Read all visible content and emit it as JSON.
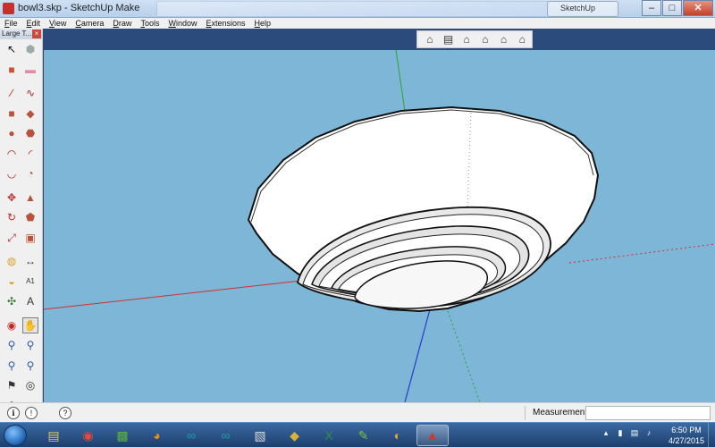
{
  "window": {
    "title": "bowl3.skp - SketchUp Make",
    "browser_tab": "SketchUp",
    "controls": {
      "minimize": "–",
      "maximize": "□",
      "close": "✕"
    }
  },
  "menu": [
    "File",
    "Edit",
    "View",
    "Camera",
    "Draw",
    "Tools",
    "Window",
    "Extensions",
    "Help"
  ],
  "toolset": {
    "title": "Large T...",
    "close": "×",
    "rows": [
      [
        {
          "name": "select-arrow-icon",
          "glyph": "↖",
          "color": "#111"
        },
        {
          "name": "make-component-icon",
          "glyph": "⬢",
          "color": "#9aa"
        }
      ],
      [
        {
          "name": "paint-bucket-icon",
          "glyph": "■",
          "color": "#c7562c"
        },
        {
          "name": "eraser-icon",
          "glyph": "▬",
          "color": "#e58aa6"
        }
      ],
      [
        {
          "name": "pencil-icon",
          "glyph": "∕",
          "color": "#b02020"
        },
        {
          "name": "freehand-icon",
          "glyph": "∿",
          "color": "#b02020"
        }
      ],
      [
        {
          "name": "rectangle-icon",
          "glyph": "■",
          "color": "#b8533a"
        },
        {
          "name": "rotated-rectangle-icon",
          "glyph": "◆",
          "color": "#b8533a"
        }
      ],
      [
        {
          "name": "circle-icon",
          "glyph": "●",
          "color": "#b8533a"
        },
        {
          "name": "polygon-icon",
          "glyph": "⬣",
          "color": "#b8533a"
        }
      ],
      [
        {
          "name": "arc-icon",
          "glyph": "◠",
          "color": "#b02020"
        },
        {
          "name": "two-point-arc-icon",
          "glyph": "◜",
          "color": "#b02020"
        }
      ],
      [
        {
          "name": "three-point-arc-icon",
          "glyph": "◡",
          "color": "#b02020"
        },
        {
          "name": "pie-icon",
          "glyph": "◔",
          "color": "#b8533a"
        }
      ],
      [
        {
          "name": "move-icon",
          "glyph": "✥",
          "color": "#c42828"
        },
        {
          "name": "push-pull-icon",
          "glyph": "▲",
          "color": "#b8533a"
        }
      ],
      [
        {
          "name": "rotate-icon",
          "glyph": "↻",
          "color": "#c42828"
        },
        {
          "name": "follow-me-icon",
          "glyph": "⬟",
          "color": "#b8533a"
        }
      ],
      [
        {
          "name": "scale-icon",
          "glyph": "⤢",
          "color": "#c42828"
        },
        {
          "name": "offset-icon",
          "glyph": "▣",
          "color": "#b8533a"
        }
      ],
      [
        {
          "name": "tape-measure-icon",
          "glyph": "◍",
          "color": "#d8a22a"
        },
        {
          "name": "dimension-icon",
          "glyph": "↔",
          "color": "#333"
        }
      ],
      [
        {
          "name": "protractor-icon",
          "glyph": "◒",
          "color": "#d8a22a"
        },
        {
          "name": "text-icon",
          "glyph": "A1",
          "color": "#333"
        }
      ],
      [
        {
          "name": "axes-icon",
          "glyph": "✣",
          "color": "#2a7a2a"
        },
        {
          "name": "3d-text-icon",
          "glyph": "A",
          "color": "#333"
        }
      ],
      [
        {
          "name": "orbit-icon",
          "glyph": "◉",
          "color": "#c42828"
        },
        {
          "name": "pan-icon",
          "glyph": "✋",
          "color": "#333"
        }
      ],
      [
        {
          "name": "zoom-icon",
          "glyph": "⚲",
          "color": "#2a5aa2"
        },
        {
          "name": "zoom-window-icon",
          "glyph": "⚲",
          "color": "#2a5aa2"
        }
      ],
      [
        {
          "name": "zoom-previous-icon",
          "glyph": "⚲",
          "color": "#2a5aa2"
        },
        {
          "name": "zoom-extents-icon",
          "glyph": "⚲",
          "color": "#2a5aa2"
        }
      ],
      [
        {
          "name": "position-camera-icon",
          "glyph": "⚑",
          "color": "#333"
        },
        {
          "name": "look-around-icon",
          "glyph": "◎",
          "color": "#333"
        }
      ],
      [
        {
          "name": "walk-icon",
          "glyph": "⚘",
          "color": "#333"
        },
        {
          "name": "section-plane-icon",
          "glyph": "◈",
          "color": "#333"
        }
      ]
    ]
  },
  "view_toolbar": [
    {
      "name": "iso-view-icon",
      "glyph": "⌂"
    },
    {
      "name": "top-view-icon",
      "glyph": "▤"
    },
    {
      "name": "front-view-icon",
      "glyph": "⌂"
    },
    {
      "name": "right-view-icon",
      "glyph": "⌂"
    },
    {
      "name": "back-view-icon",
      "glyph": "⌂"
    },
    {
      "name": "left-view-icon",
      "glyph": "⌂"
    }
  ],
  "viewport": {
    "background": "#7db6d6",
    "model_fill": "#ffffff",
    "edge_color": "#111111",
    "axis_red": "#d23030",
    "axis_green": "#2aa52a",
    "axis_blue": "#2a3ac8"
  },
  "status": {
    "measurements_label": "Measurements",
    "measurements_value": "",
    "icons": [
      "ℹ",
      "!",
      "?"
    ]
  },
  "taskbar": {
    "apps": [
      {
        "name": "file-explorer-icon",
        "glyph": "▤",
        "color": "#e7c65a"
      },
      {
        "name": "chrome-icon",
        "glyph": "◉",
        "color": "#e14b3b"
      },
      {
        "name": "color-blocks-icon",
        "glyph": "▩",
        "color": "#59b246"
      },
      {
        "name": "firefox-icon",
        "glyph": "◕",
        "color": "#f08a24"
      },
      {
        "name": "arduino-icon",
        "glyph": "∞",
        "color": "#1aa0a0"
      },
      {
        "name": "arduino-2-icon",
        "glyph": "∞",
        "color": "#1aa0a0"
      },
      {
        "name": "pdf-viewer-icon",
        "glyph": "▧",
        "color": "#d9d9d9"
      },
      {
        "name": "cube-icon",
        "glyph": "◆",
        "color": "#d8b23a"
      },
      {
        "name": "excel-icon",
        "glyph": "X",
        "color": "#2f8f3f"
      },
      {
        "name": "notepad-icon",
        "glyph": "✎",
        "color": "#7fbf3f"
      },
      {
        "name": "paint-icon",
        "glyph": "◐",
        "color": "#e0a040"
      },
      {
        "name": "sketchup-icon",
        "glyph": "▲",
        "color": "#d8322c"
      }
    ],
    "tray_icons": [
      "▴",
      "▮",
      "▤",
      "♪"
    ],
    "time": "6:50 PM",
    "date": "4/27/2015"
  }
}
